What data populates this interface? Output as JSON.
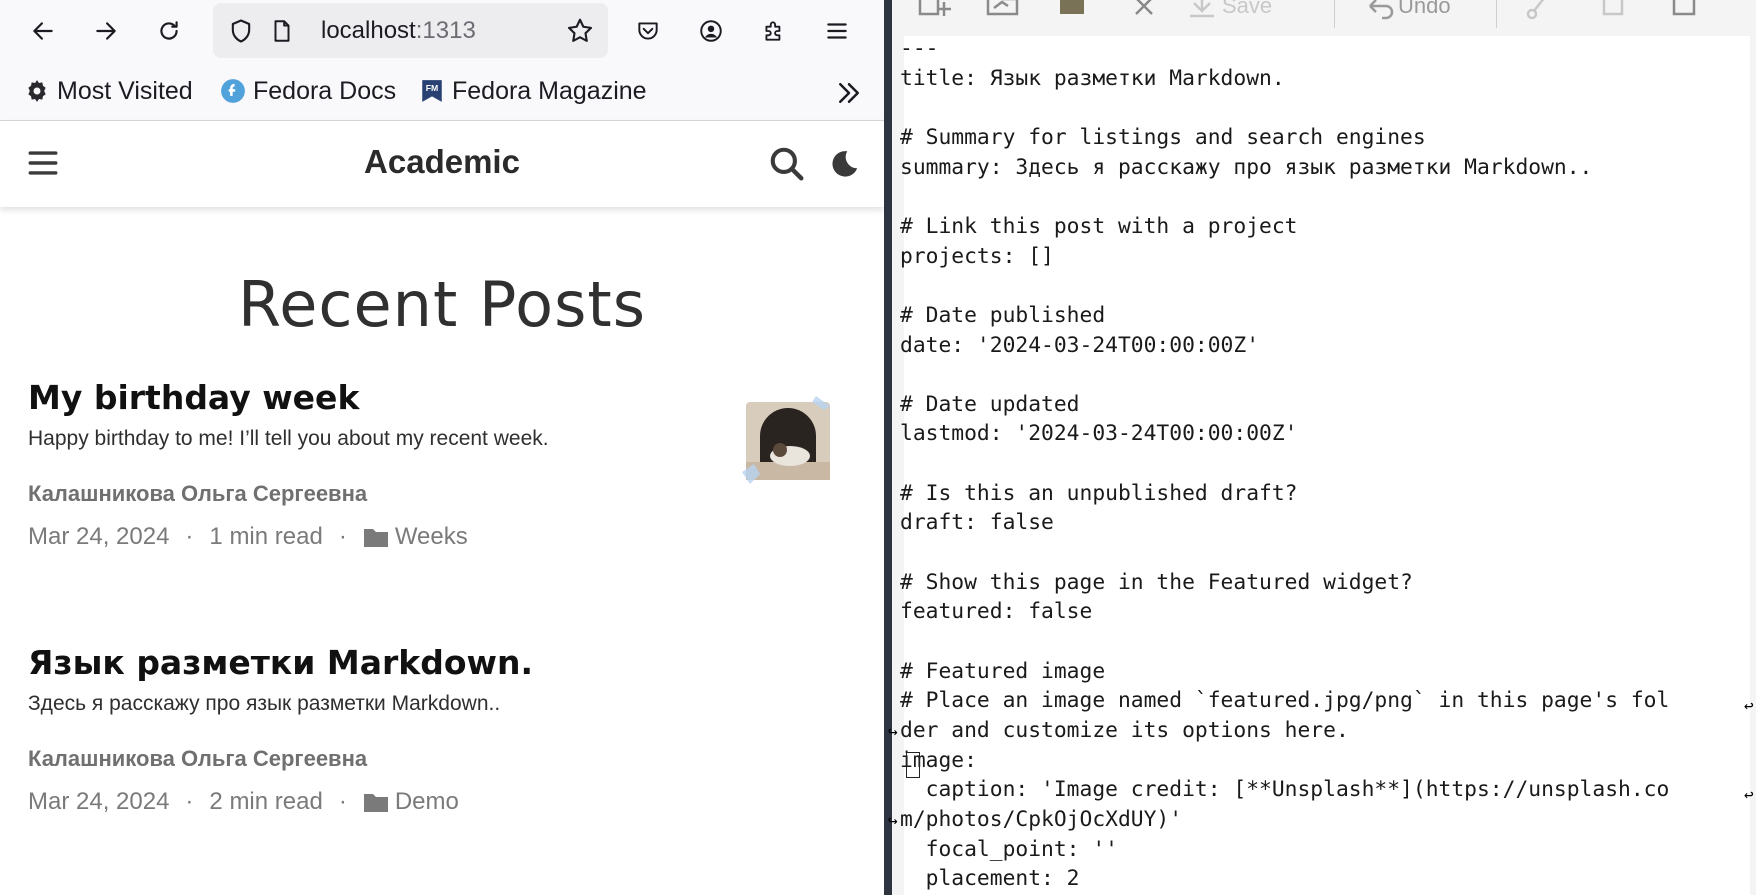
{
  "browser": {
    "url_host": "localhost",
    "url_port": ":1313",
    "bookmarks": [
      {
        "label": "Most Visited",
        "icon": "gear-icon"
      },
      {
        "label": "Fedora Docs",
        "icon": "fedora-icon"
      },
      {
        "label": "Fedora Magazine",
        "icon": "fedora-magazine-icon"
      }
    ],
    "bookmarks_overflow": "»"
  },
  "site": {
    "title": "Academic",
    "section_heading": "Recent Posts",
    "posts": [
      {
        "title": "My birthday week",
        "summary": "Happy birthday to me! I’ll tell you about my recent week.",
        "author": "Калашникова Ольга Сергеевна",
        "date": "Mar 24, 2024",
        "read_time": "1 min read",
        "category": "Weeks"
      },
      {
        "title": "Язык разметки Markdown.",
        "summary": "Здесь я расскажу про язык разметки Markdown..",
        "author": "Калашникова Ольга Сергеевна",
        "date": "Mar 24, 2024",
        "read_time": "2 min read",
        "category": "Demo"
      }
    ],
    "meta_separator": "·"
  },
  "editor": {
    "toolbar": {
      "save_label": "Save",
      "undo_label": "Undo"
    },
    "lines": [
      "---",
      "title: Язык разметки Markdown.",
      "",
      "# Summary for listings and search engines",
      "summary: Здесь я расскажу про язык разметки Markdown..",
      "",
      "# Link this post with a project",
      "projects: []",
      "",
      "# Date published",
      "date: '2024-03-24T00:00:00Z'",
      "",
      "# Date updated",
      "lastmod: '2024-03-24T00:00:00Z'",
      "",
      "# Is this an unpublished draft?",
      "draft: false",
      "",
      "# Show this page in the Featured widget?",
      "featured: false",
      "",
      "# Featured image",
      "# Place an image named `featured.jpg/png` in this page's fol",
      "der and customize its options here.",
      "image:",
      "  caption: 'Image credit: [**Unsplash**](https://unsplash.co",
      "m/photos/CpkOjOcXdUY)'",
      "  focal_point: ''",
      "  placement: 2"
    ]
  }
}
